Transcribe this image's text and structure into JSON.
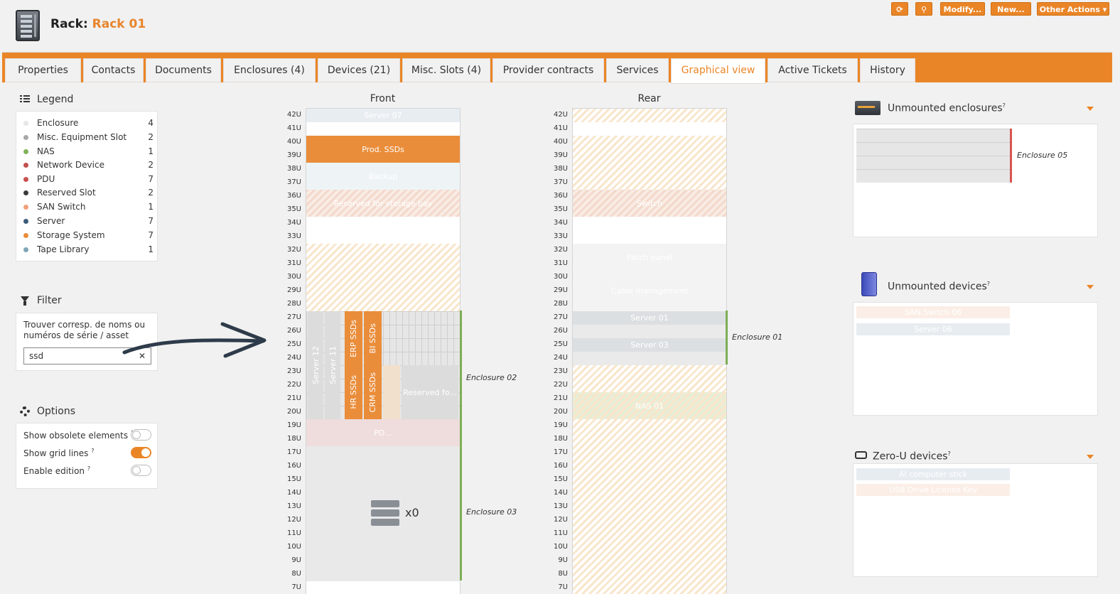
{
  "header": {
    "rack_prefix": "Rack:",
    "rack_name": "Rack 01",
    "buttons": {
      "refresh": "⟳",
      "search": "⚲",
      "modify": "Modify...",
      "new": "New...",
      "other": "Other Actions ▾"
    }
  },
  "tabs": [
    "Properties",
    "Contacts",
    "Documents",
    "Enclosures (4)",
    "Devices (21)",
    "Misc. Slots (4)",
    "Provider contracts",
    "Services",
    "Graphical view",
    "Active Tickets",
    "History"
  ],
  "active_tab": "Graphical view",
  "legend": {
    "title": "Legend",
    "items": [
      {
        "label": "Enclosure",
        "count": "4",
        "color": "#e6e6e6"
      },
      {
        "label": "Misc. Equipment Slot",
        "count": "2",
        "color": "#a8a8a8"
      },
      {
        "label": "NAS",
        "count": "1",
        "color": "#7fb35b"
      },
      {
        "label": "Network Device",
        "count": "2",
        "color": "#c0504d"
      },
      {
        "label": "PDU",
        "count": "7",
        "color": "#c9504f"
      },
      {
        "label": "Reserved Slot",
        "count": "2",
        "color": "#3a3a3a"
      },
      {
        "label": "SAN Switch",
        "count": "1",
        "color": "#f2a07a"
      },
      {
        "label": "Server",
        "count": "7",
        "color": "#3c5a7a"
      },
      {
        "label": "Storage System",
        "count": "7",
        "color": "#ea8d3a"
      },
      {
        "label": "Tape Library",
        "count": "1",
        "color": "#7fa6b8"
      }
    ]
  },
  "filter": {
    "title": "Filter",
    "hint": "Trouver corresp. de noms ou numéros de série / asset",
    "value": "ssd",
    "clear": "✕"
  },
  "options": {
    "title": "Options",
    "items": [
      {
        "label": "Show obsolete elements",
        "sup": "?",
        "on": false
      },
      {
        "label": "Show grid lines",
        "sup": "?",
        "on": true
      },
      {
        "label": "Enable edition",
        "sup": "?",
        "on": false
      }
    ]
  },
  "rack": {
    "front_title": "Front",
    "rear_title": "Rear",
    "units": [
      "42U",
      "41U",
      "40U",
      "39U",
      "38U",
      "37U",
      "36U",
      "35U",
      "34U",
      "33U",
      "32U",
      "31U",
      "30U",
      "29U",
      "28U",
      "27U",
      "26U",
      "25U",
      "24U",
      "23U",
      "22U",
      "21U",
      "20U",
      "19U",
      "18U",
      "17U",
      "16U",
      "15U",
      "14U",
      "13U",
      "12U",
      "11U",
      "10U",
      "9U",
      "8U",
      "7U"
    ],
    "front": {
      "server07": "Server 07",
      "prod_ssds": "Prod. SSDs",
      "backup": "Backup",
      "reserved_storage": "Reserved for storage bay",
      "server12": "Server 12",
      "server11": "Server 11",
      "erp": "ERP SSDs",
      "bi": "BI SSDs",
      "hr": "HR SSDs",
      "crm": "CRM SSDs",
      "reserved_fo": "Reserved fo...",
      "pdu_label": "PD...",
      "enclosure02": "Enclosure 02",
      "enclosure03": "Enclosure 03",
      "count": "x0"
    },
    "rear": {
      "switch": "Switch",
      "patch": "Patch panel",
      "cable": "Cable management",
      "server01": "Server 01",
      "server03": "Server 03",
      "nas": "NAS 01",
      "enclosure01": "Enclosure 01"
    }
  },
  "right": {
    "unmounted_enclosures": {
      "title": "Unmounted enclosures",
      "sup": "?",
      "label": "Enclosure 05"
    },
    "unmounted_devices": {
      "title": "Unmounted devices",
      "sup": "?",
      "items": [
        "SAN Switch 06",
        "Server 06"
      ]
    },
    "zero_u": {
      "title": "Zero-U devices",
      "sup": "?",
      "items": [
        "AI computer stick",
        "USB Drive License Key"
      ]
    }
  }
}
